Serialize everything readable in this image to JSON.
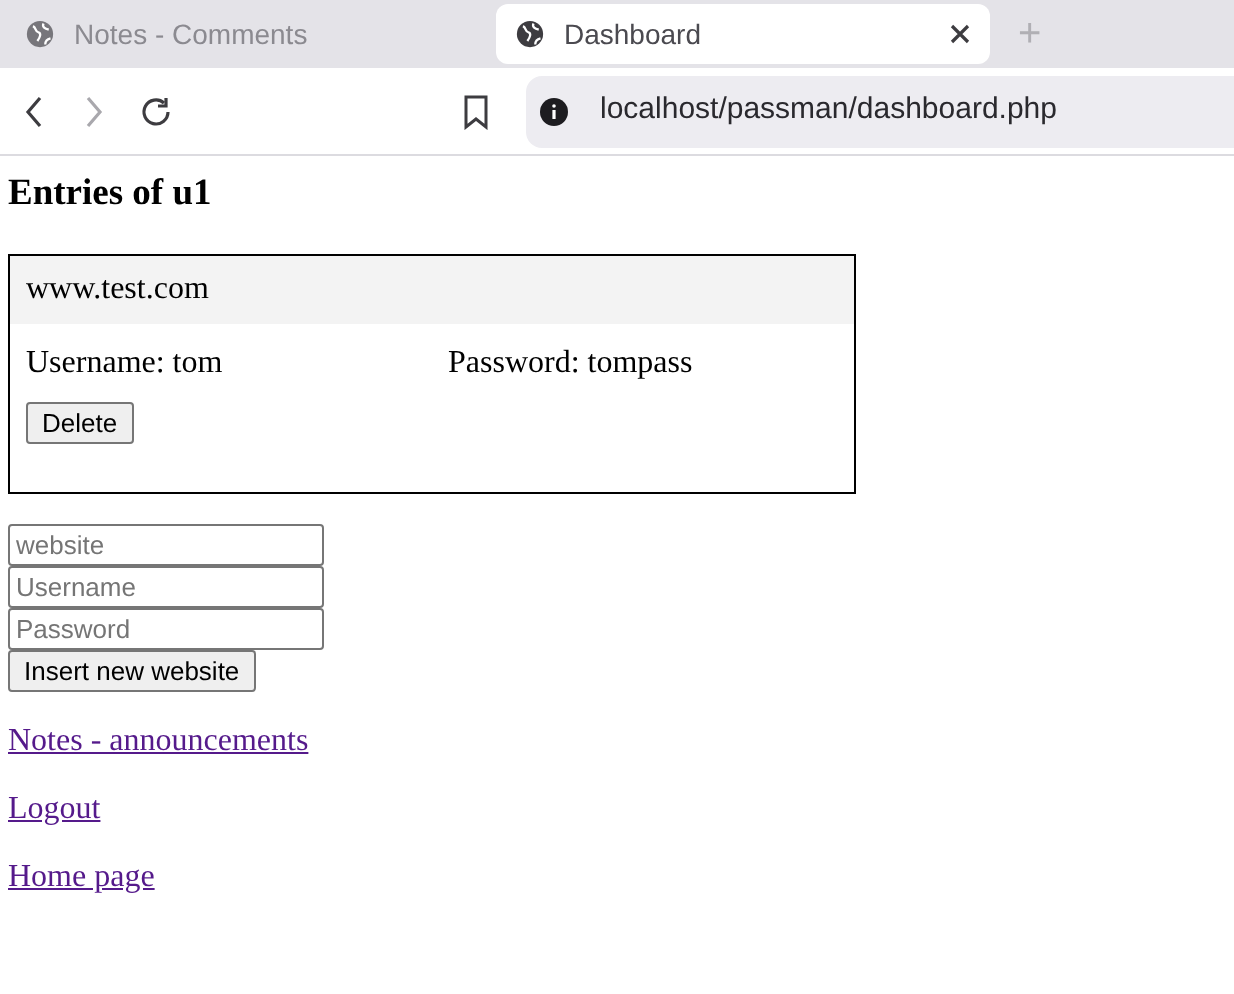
{
  "browser": {
    "tabs": [
      {
        "title": "Notes - Comments",
        "selected": false
      },
      {
        "title": "Dashboard",
        "selected": true
      }
    ],
    "new_tab": "+",
    "url": "localhost/passman/dashboard.php"
  },
  "page": {
    "heading": "Entries of u1",
    "entries": [
      {
        "website": "www.test.com",
        "username": "Username: tom",
        "password": "Password: tompass",
        "delete_button": "Delete"
      }
    ],
    "form": {
      "fields": [
        {
          "placeholder": "website"
        },
        {
          "placeholder": "Username"
        },
        {
          "placeholder": "Password"
        }
      ],
      "submit": "Insert new website"
    },
    "links": [
      "Notes - announcements",
      "Logout",
      "Home page"
    ]
  }
}
